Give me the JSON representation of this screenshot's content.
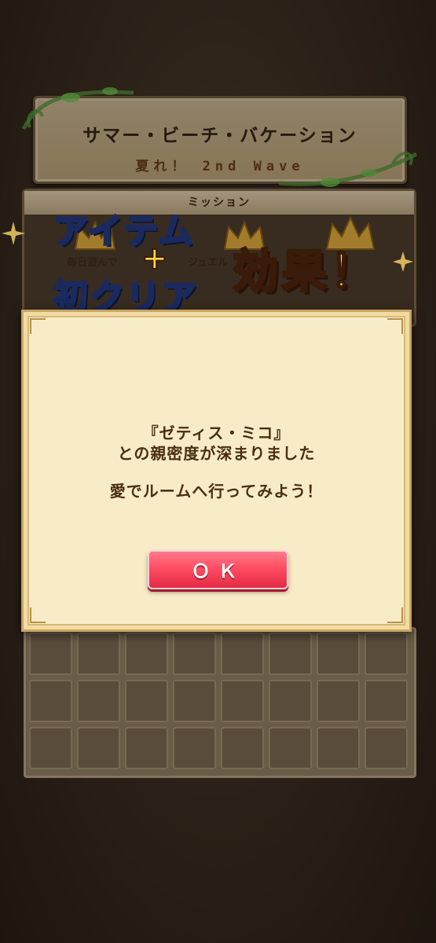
{
  "event": {
    "title": "サマー・ビーチ・バケーション",
    "subtitle": "夏れ！ 2nd Wave"
  },
  "mission": {
    "header": "ミッション",
    "chip_left": "毎日遊んで",
    "chip_right": "ジュエル"
  },
  "promo_logo": {
    "line1": "アイテム",
    "plus": "+",
    "line2": "初クリア",
    "effect": "効果！"
  },
  "dialog": {
    "line1": "『ゼティス・ミコ』",
    "line2": "との親密度が深まりました",
    "line3": "愛でルームへ行ってみよう！",
    "ok_label": "ＯＫ"
  },
  "colors": {
    "dialog_bg": "#f8ecc8",
    "ok_button": "#ff4d62",
    "logo_blue": "#7fd9ff",
    "logo_yellow": "#ffd93a"
  }
}
